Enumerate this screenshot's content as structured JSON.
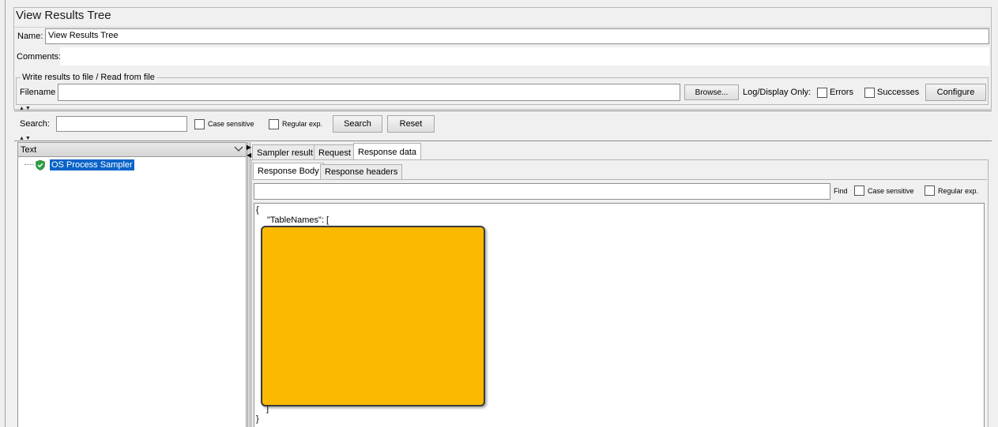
{
  "window": {
    "title": "View Results Tree"
  },
  "form": {
    "name_label": "Name:",
    "name_value": "View Results Tree",
    "comments_label": "Comments:",
    "comments_value": ""
  },
  "file_group": {
    "legend": "Write results to file / Read from file",
    "filename_label": "Filename",
    "filename_value": "",
    "browse_button": "Browse...",
    "log_display_label": "Log/Display Only:",
    "errors_label": "Errors",
    "successes_label": "Successes",
    "configure_button": "Configure"
  },
  "search": {
    "label": "Search:",
    "value": "",
    "case_sensitive_label": "Case sensitive",
    "regex_label": "Regular exp.",
    "search_button": "Search",
    "reset_button": "Reset"
  },
  "tree": {
    "renderer_selected": "Text",
    "items": [
      {
        "label": "OS Process Sampler",
        "status": "success",
        "selected": true
      }
    ]
  },
  "result_tabs": [
    "Sampler result",
    "Request",
    "Response data"
  ],
  "active_result_tab": "Response data",
  "response_tabs": [
    "Response Body",
    "Response headers"
  ],
  "active_response_tab": "Response Body",
  "find": {
    "value": "",
    "find_label": "Find",
    "case_sensitive_label": "Case sensitive",
    "regex_label": "Regular exp."
  },
  "response_body": {
    "lines": [
      "{",
      "\"TableNames\": [",
      "]",
      "}"
    ]
  },
  "colors": {
    "selection": "#0a64c9",
    "success_icon": "#2ea043",
    "redaction": "#fbb901"
  },
  "icons": [
    "shield-check-icon",
    "chevron-down-icon",
    "collapse-arrows-icon",
    "tab-scroll-arrow-icon"
  ]
}
